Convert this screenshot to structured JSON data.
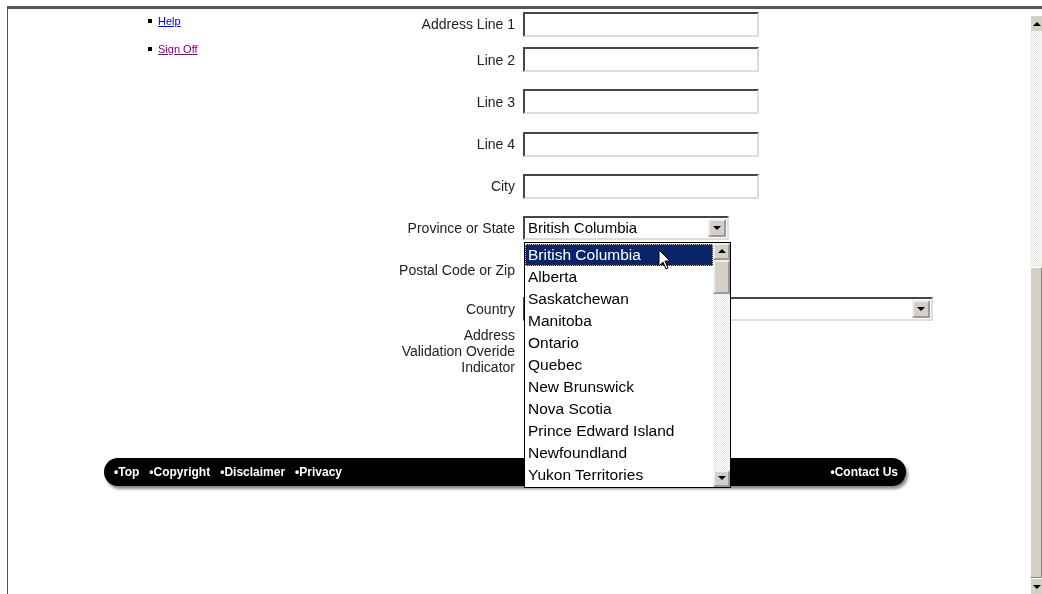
{
  "nav": [
    {
      "label": "Help",
      "visited": false
    },
    {
      "label": "Sign Off",
      "visited": true
    }
  ],
  "form": {
    "fields": [
      {
        "label": "Address Line 1",
        "kind": "text"
      },
      {
        "label": "Line 2",
        "kind": "text"
      },
      {
        "label": "Line 3",
        "kind": "text"
      },
      {
        "label": "Line 4",
        "kind": "text"
      },
      {
        "label": "City",
        "kind": "text"
      },
      {
        "label": "Province or State",
        "kind": "select",
        "value": "British Columbia",
        "open": true,
        "options": [
          {
            "label": "British Columbia",
            "selected": true
          },
          {
            "label": "Alberta",
            "selected": false
          },
          {
            "label": "Saskatchewan",
            "selected": false
          },
          {
            "label": "Manitoba",
            "selected": false
          },
          {
            "label": "Ontario",
            "selected": false
          },
          {
            "label": "Quebec",
            "selected": false
          },
          {
            "label": "New Brunswick",
            "selected": false
          },
          {
            "label": "Nova Scotia",
            "selected": false
          },
          {
            "label": "Prince Edward Island",
            "selected": false
          },
          {
            "label": "Newfoundland",
            "selected": false
          },
          {
            "label": "Yukon Territories",
            "selected": false
          }
        ]
      },
      {
        "label": "Postal Code or Zip",
        "kind": "covered"
      },
      {
        "label": "Country",
        "kind": "wide-select"
      },
      {
        "label": "Address\nValidation Overide\nIndicator",
        "kind": "none"
      }
    ]
  },
  "footer": {
    "left_links": [
      "•Top",
      "•Copyright",
      "•Disclaimer",
      "•Privacy"
    ],
    "right_links": [
      "•Contact Us"
    ]
  }
}
